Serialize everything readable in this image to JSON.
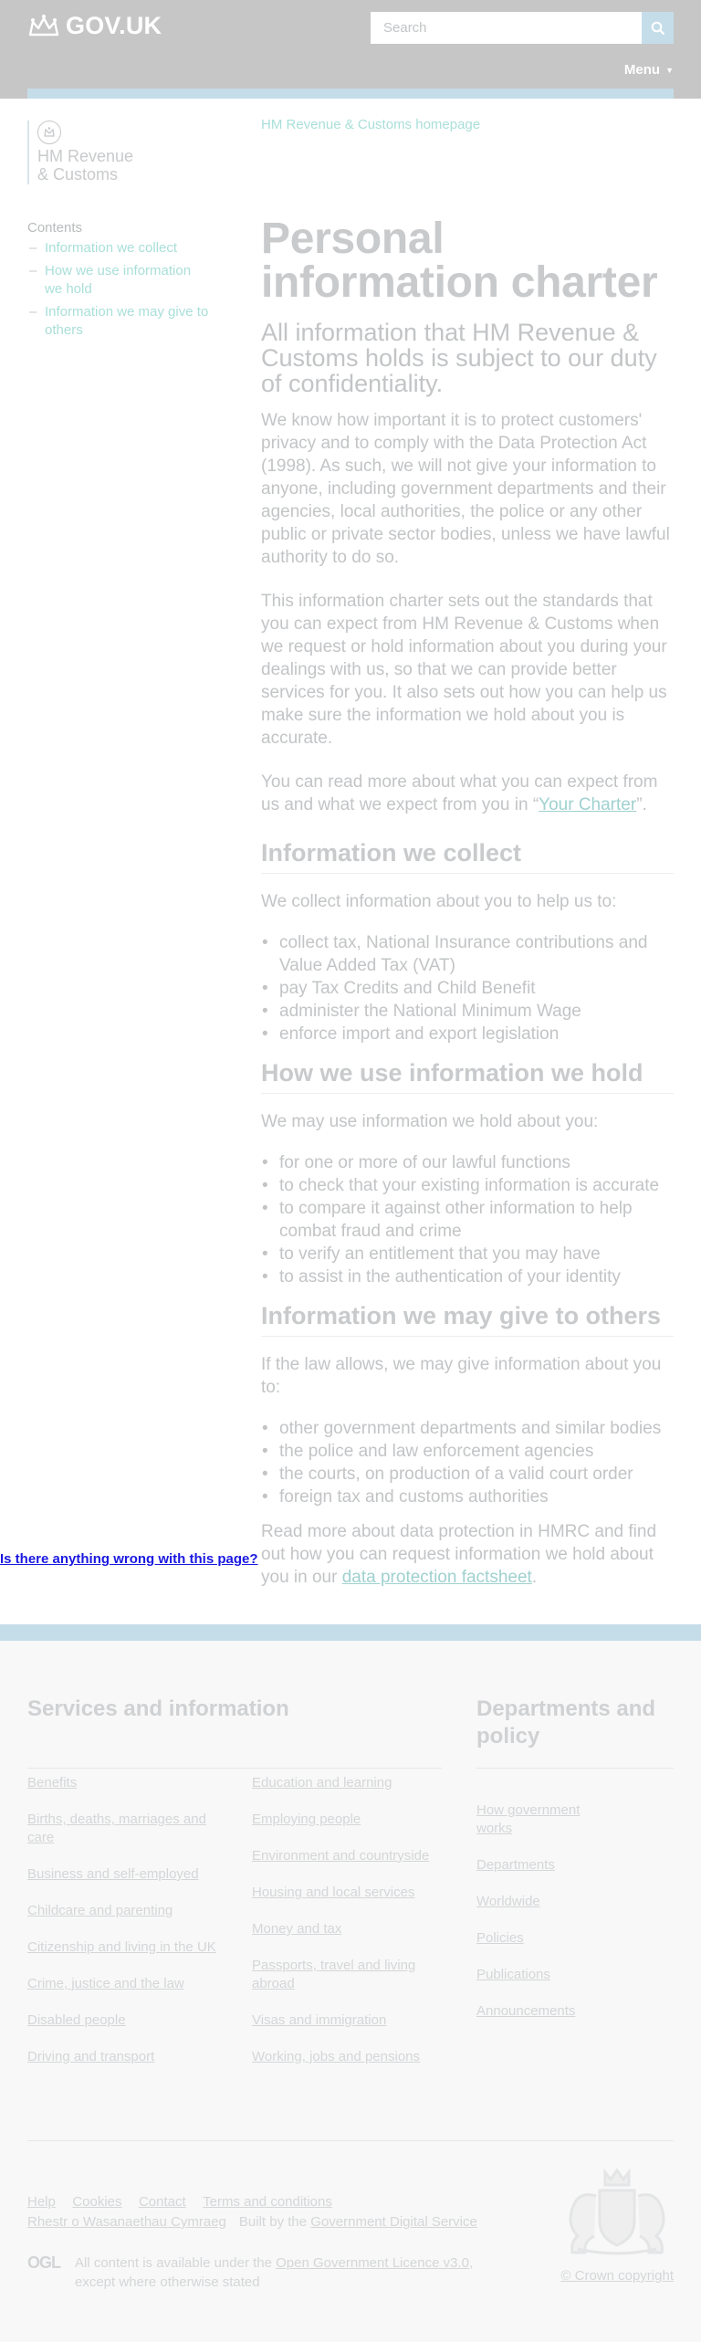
{
  "header": {
    "logo_text": "GOV.UK",
    "search_placeholder": "Search",
    "menu_label": "Menu",
    "colors": {
      "header_bg": "#c6c6c6",
      "accent": "#c5dde9"
    }
  },
  "organisation": {
    "line1": "HM Revenue",
    "line2": "& Customs"
  },
  "homepage_link": "HM Revenue & Customs homepage",
  "contents": {
    "heading": "Contents",
    "items": [
      {
        "label": "Information we collect"
      },
      {
        "label": "How we use information we hold"
      },
      {
        "label": "Information we may give to others"
      }
    ]
  },
  "main": {
    "title": "Personal information charter",
    "lead": "All information that HM Revenue & Customs holds is subject to our duty of confidentiality.",
    "para1": "We know how important it is to protect customers' privacy and to comply with the Data Protection Act (1998). As such, we will not give your information to anyone, including government departments and their agencies, local authorities, the police or any other public or private sector bodies, unless we have lawful authority to do so.",
    "para2": "This information charter sets out the standards that you can expect from HM Revenue & Customs when we request or hold information about you during your dealings with us, so that we can provide better services for you. It also sets out how you can help us make sure the information we hold about you is accurate.",
    "para3_before": "You can read more about what you can expect from us and what we expect from you in “",
    "para3_link": "Your Charter",
    "para3_after": "”.",
    "section1": {
      "heading": "Information we collect",
      "intro": "We collect information about you to help us to:",
      "items": [
        "collect tax, National Insurance contributions and Value Added Tax (VAT)",
        "pay Tax Credits and Child Benefit",
        "administer the National Minimum Wage",
        "enforce import and export legislation"
      ]
    },
    "section2": {
      "heading": "How we use information we hold",
      "intro": "We may use information we hold about you:",
      "items": [
        "for one or more of our lawful functions",
        "to check that your existing information is accurate",
        "to compare it against other information to help combat fraud and crime",
        "to verify an entitlement that you may have",
        "to assist in the authentication of your identity"
      ]
    },
    "section3": {
      "heading": "Information we may give to others",
      "intro": "If the law allows, we may give information about you to:",
      "items": [
        "other government departments and similar bodies",
        "the police and law enforcement agencies",
        "the courts, on production of a valid court order",
        "foreign tax and customs authorities"
      ]
    },
    "closing_before": "Read more about data protection in HMRC and find out how you can request information we hold about you in our ",
    "closing_link": "data protection factsheet",
    "closing_after": "."
  },
  "feedback_link": "Is there anything wrong with this page?",
  "footer": {
    "services_heading": "Services and information",
    "services_col1": [
      "Benefits",
      "Births, deaths, marriages and care",
      "Business and self-employed",
      "Childcare and parenting",
      "Citizenship and living in the UK",
      "Crime, justice and the law",
      "Disabled people",
      "Driving and transport"
    ],
    "services_col2": [
      "Education and learning",
      "Employing people",
      "Environment and countryside",
      "Housing and local services",
      "Money and tax",
      "Passports, travel and living abroad",
      "Visas and immigration",
      "Working, jobs and pensions"
    ],
    "departments_heading": "Departments and policy",
    "departments": [
      "How government works",
      "Departments",
      "Worldwide",
      "Policies",
      "Publications",
      "Announcements"
    ],
    "meta_links": [
      "Help",
      "Cookies",
      "Contact",
      "Terms and conditions",
      "Rhestr o Wasanaethau Cymraeg"
    ],
    "built_by_prefix": "Built by the ",
    "built_by_link": "Government Digital Service",
    "ogl_badge": "OGL",
    "licence_before": "All content is available under the ",
    "licence_link": "Open Government Licence v3.0",
    "licence_after": ", except where otherwise stated",
    "copyright": "© Crown copyright"
  }
}
